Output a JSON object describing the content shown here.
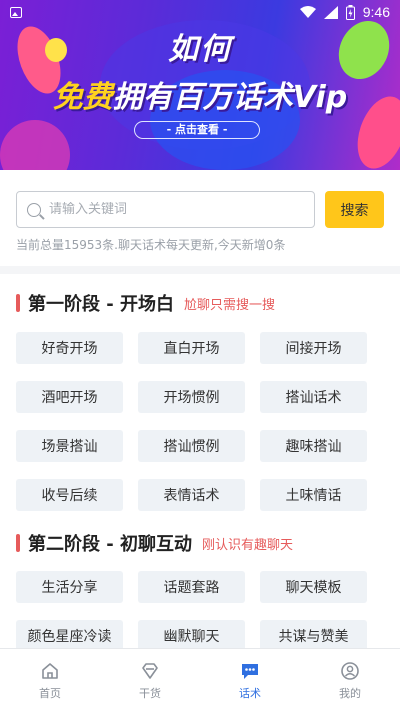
{
  "status_bar": {
    "time": "9:46"
  },
  "banner": {
    "line1": "如何",
    "line2_highlight": "免费",
    "line2_rest": "拥有百万话术Vip",
    "cta": "- 点击查看 -"
  },
  "search": {
    "placeholder": "请输入关键词",
    "button_label": "搜索",
    "stats": "当前总量15953条.聊天话术每天更新,今天新增0条"
  },
  "sections": [
    {
      "title": "第一阶段 - 开场白",
      "subtitle": "尬聊只需搜一搜",
      "tags": [
        "好奇开场",
        "直白开场",
        "间接开场",
        "酒吧开场",
        "开场惯例",
        "搭讪话术",
        "场景搭讪",
        "搭讪惯例",
        "趣味搭讪",
        "收号后续",
        "表情话术",
        "土味情话"
      ]
    },
    {
      "title": "第二阶段 - 初聊互动",
      "subtitle": "刚认识有趣聊天",
      "tags": [
        "生活分享",
        "话题套路",
        "聊天模板",
        "颜色星座冷读",
        "幽默聊天",
        "共谋与赞美"
      ]
    }
  ],
  "bottom_nav": {
    "items": [
      {
        "label": "首页",
        "icon": "home-icon",
        "active": false
      },
      {
        "label": "干货",
        "icon": "diamond-icon",
        "active": false
      },
      {
        "label": "话术",
        "icon": "chat-icon",
        "active": true
      },
      {
        "label": "我的",
        "icon": "user-icon",
        "active": false
      }
    ]
  },
  "colors": {
    "accent_yellow": "#ffc61a",
    "section_red": "#e65b5b",
    "active_blue": "#2f6fe0"
  }
}
